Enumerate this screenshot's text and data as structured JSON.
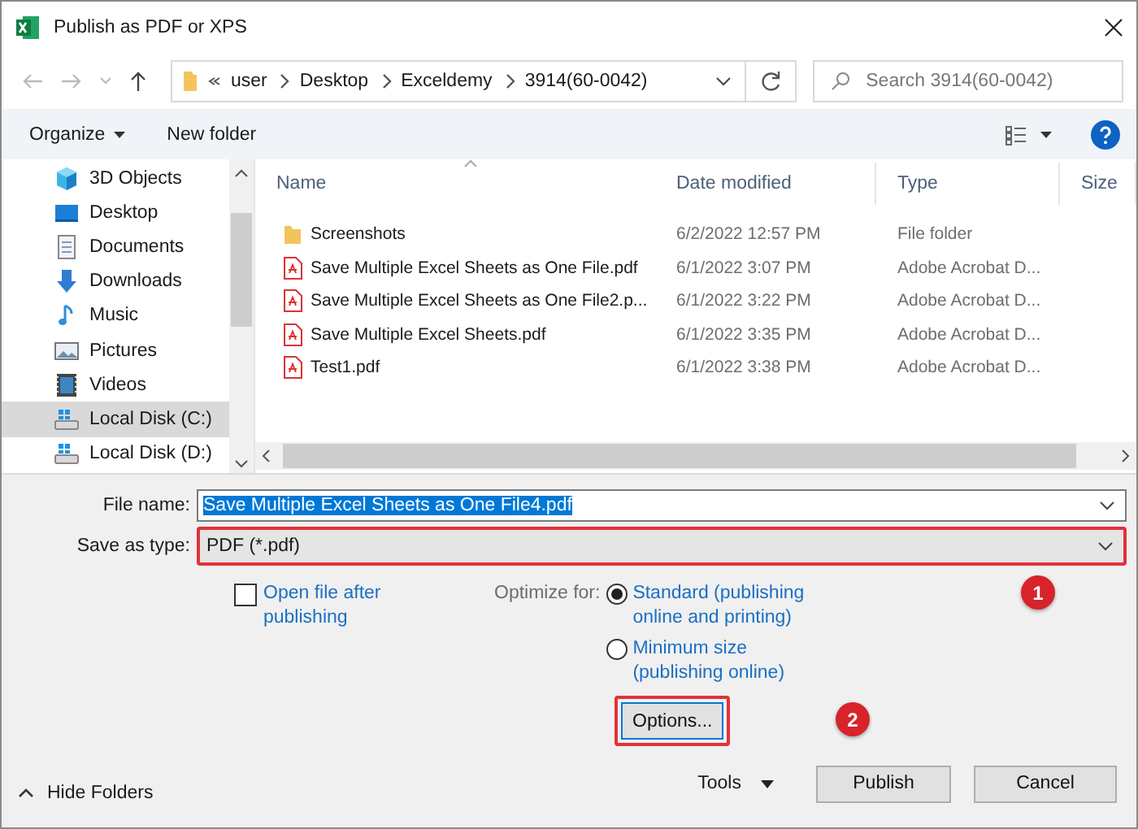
{
  "window": {
    "title": "Publish as PDF or XPS"
  },
  "address": {
    "path": [
      "user",
      "Desktop",
      "Exceldemy",
      "3914(60-0042)"
    ]
  },
  "search": {
    "placeholder": "Search 3914(60-0042)"
  },
  "toolbar": {
    "organize": "Organize",
    "new_folder": "New folder"
  },
  "sidebar": {
    "items": [
      {
        "label": "3D Objects",
        "kind": "cube",
        "selected": false
      },
      {
        "label": "Desktop",
        "kind": "desktop",
        "selected": false
      },
      {
        "label": "Documents",
        "kind": "document",
        "selected": false
      },
      {
        "label": "Downloads",
        "kind": "download",
        "selected": false
      },
      {
        "label": "Music",
        "kind": "music",
        "selected": false
      },
      {
        "label": "Pictures",
        "kind": "picture",
        "selected": false
      },
      {
        "label": "Videos",
        "kind": "video",
        "selected": false
      },
      {
        "label": "Local Disk (C:)",
        "kind": "drive",
        "selected": true
      },
      {
        "label": "Local Disk (D:)",
        "kind": "drive",
        "selected": false
      }
    ]
  },
  "file_list": {
    "columns": [
      "Name",
      "Date modified",
      "Type",
      "Size"
    ],
    "rows": [
      {
        "kind": "folder",
        "name": "Screenshots",
        "date": "6/2/2022 12:57 PM",
        "type": "File folder"
      },
      {
        "kind": "pdf",
        "name": "Save Multiple Excel Sheets as One File.pdf",
        "date": "6/1/2022 3:07 PM",
        "type": "Adobe Acrobat D..."
      },
      {
        "kind": "pdf",
        "name": "Save Multiple Excel Sheets as One File2.p...",
        "date": "6/1/2022 3:22 PM",
        "type": "Adobe Acrobat D..."
      },
      {
        "kind": "pdf",
        "name": "Save Multiple Excel Sheets.pdf",
        "date": "6/1/2022 3:35 PM",
        "type": "Adobe Acrobat D..."
      },
      {
        "kind": "pdf",
        "name": "Test1.pdf",
        "date": "6/1/2022 3:38 PM",
        "type": "Adobe Acrobat D..."
      }
    ]
  },
  "form": {
    "file_name": {
      "label": "File name:",
      "value": "Save Multiple Excel Sheets as One File4.pdf",
      "value_selected": true
    },
    "save_as_type": {
      "label": "Save as type:",
      "value": "PDF (*.pdf)",
      "callout": "1"
    },
    "open_after": {
      "label": "Open file after publishing",
      "checked": false
    },
    "optimize": {
      "label": "Optimize for:",
      "options": [
        {
          "label": "Standard (publishing online and printing)",
          "selected": true
        },
        {
          "label": "Minimum size (publishing online)",
          "selected": false
        }
      ]
    },
    "options_button": {
      "label": "Options...",
      "callout": "2"
    }
  },
  "footer": {
    "hide_folders": "Hide Folders",
    "tools": "Tools",
    "buttons": [
      "Publish",
      "Cancel"
    ]
  }
}
